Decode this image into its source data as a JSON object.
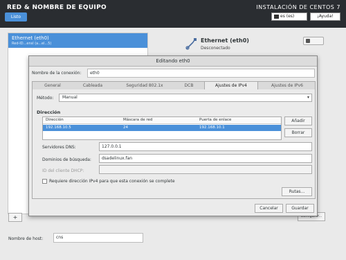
{
  "header": {
    "title": "RED & NOMBRE DE EQUIPO",
    "done_label": "Listo",
    "installer_title": "INSTALACIÓN DE CENTOS 7",
    "keyboard_layout": "es (es)",
    "help_label": "¡Ayuda!"
  },
  "network_list": {
    "selected_item": {
      "name": "Ethernet (eth0)",
      "description": "Red-ID...ensl (a...el...5)"
    },
    "add_label": "+"
  },
  "device": {
    "name": "Ethernet (eth0)",
    "status": "Desconectado",
    "icon": "network-cable-icon"
  },
  "configure_label": "Configurar...",
  "hostname": {
    "label": "Nombre de host:",
    "value": "cns"
  },
  "dialog": {
    "title": "Editando eth0",
    "connection_name_label": "Nombre de la conexión:",
    "connection_name_value": "eth0",
    "tabs": [
      {
        "label": "General"
      },
      {
        "label": "Cableada"
      },
      {
        "label": "Seguridad 802.1x"
      },
      {
        "label": "DCB"
      },
      {
        "label": "Ajustes de IPv4"
      },
      {
        "label": "Ajustes de IPv6"
      }
    ],
    "active_tab": "Ajustes de IPv4",
    "method_label": "Método:",
    "method_value": "Manual",
    "address_section_label": "Dirección",
    "address_table": {
      "headers": [
        "Dirección",
        "Máscara de red",
        "Puerta de enlace"
      ],
      "rows": [
        [
          "192.168.10.5",
          "24",
          "192.168.10.1"
        ]
      ]
    },
    "add_button": "Añadir",
    "delete_button": "Borrar",
    "dns_label": "Servidores DNS:",
    "dns_value": "127.0.0.1",
    "search_label": "Dominios de búsqueda:",
    "search_value": "dsadelinux.fan",
    "dhcp_label": "ID del cliente DHCP:",
    "dhcp_value": "",
    "require_ipv4_label": "Requiere dirección IPv4 para que esta conexión se complete",
    "routes_button": "Rutas...",
    "cancel_button": "Cancelar",
    "save_button": "Guardar"
  },
  "colors": {
    "accent": "#4a90d9",
    "header_bg": "#2a2d31"
  }
}
